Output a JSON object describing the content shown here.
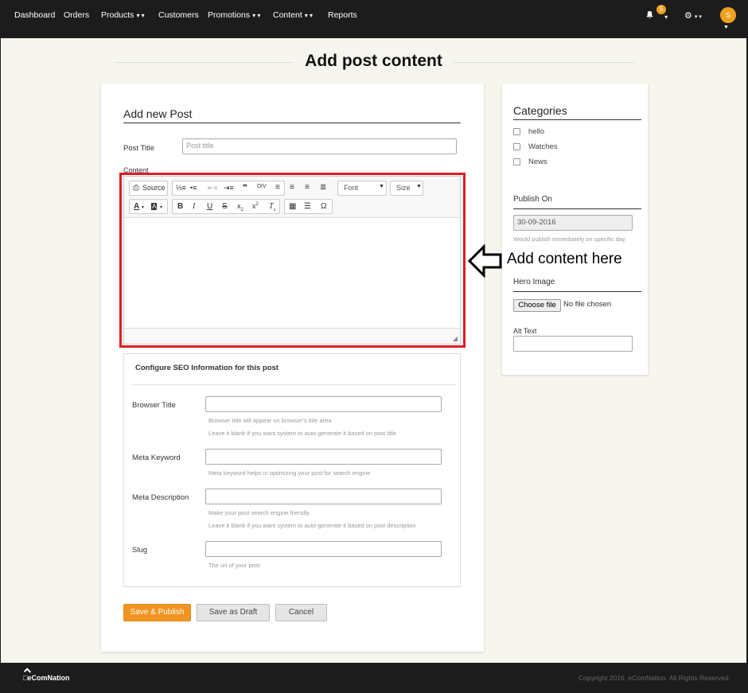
{
  "nav": {
    "items": [
      "Dashboard",
      "Orders",
      "Products",
      "Customers",
      "Promotions",
      "Content",
      "Reports"
    ],
    "notification_count": "5",
    "avatar_initial": "S"
  },
  "page": {
    "title": "Add post content"
  },
  "form": {
    "heading": "Add new Post",
    "post_title_label": "Post Title",
    "post_title_placeholder": "Post title",
    "content_label": "Content"
  },
  "editor": {
    "source_label": "Source",
    "font_label": "Font",
    "size_label": "Size"
  },
  "seo": {
    "heading": "Configure SEO Information for this post",
    "browser_title_label": "Browser Title",
    "browser_title_hint1": "Browser title will appear on browser's title area",
    "browser_title_hint2": "Leave it blank if you want system to auto-generate it based on post title",
    "meta_keyword_label": "Meta Keyword",
    "meta_keyword_hint": "Meta keyword helps in optimizing your post for search engine",
    "meta_description_label": "Meta Description",
    "meta_description_hint1": "Make your post search engine friendly",
    "meta_description_hint2": "Leave it blank if you want system to auto-generate it based on post description",
    "slug_label": "Slug",
    "slug_hint": "The url of your post"
  },
  "buttons": {
    "save_publish": "Save & Publish",
    "save_draft": "Save as Draft",
    "cancel": "Cancel"
  },
  "sidebar": {
    "categories_heading": "Categories",
    "categories": [
      "hello",
      "Watches",
      "News"
    ],
    "publish_heading": "Publish On",
    "publish_date": "30-09-2016",
    "publish_hint": "Would publish immediately on specific day",
    "hero_heading": "Hero Image",
    "choose_file_label": "Choose file",
    "no_file_label": "No file chosen",
    "alt_text_label": "Alt Text"
  },
  "annotation": {
    "text": "Add content here"
  },
  "footer": {
    "brand": "eComNation",
    "copyright": "Copyright 2016, eComNation. All Rights Reserved."
  },
  "colors": {
    "accent": "#f29421",
    "highlight": "#e01b24",
    "nav_bg": "#1c1c1c"
  }
}
